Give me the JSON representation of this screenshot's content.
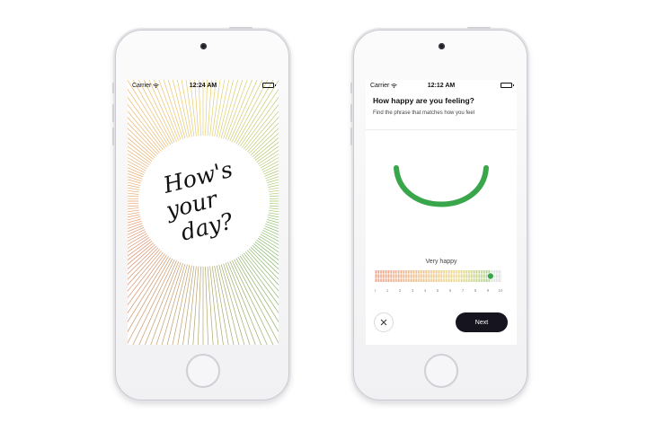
{
  "left_phone": {
    "status": {
      "carrier": "Carrier",
      "time": "12:24 AM"
    },
    "greeting": {
      "lines": [
        "How's",
        "your",
        "day?"
      ]
    }
  },
  "right_phone": {
    "status": {
      "carrier": "Carrier",
      "time": "12:12 AM"
    },
    "header": {
      "title": "How happy are you feeling?",
      "subtitle": "Find the phrase that matches how you feel"
    },
    "mood": {
      "label": "Very happy",
      "scale_labels": [
        "0",
        "1",
        "2",
        "3",
        "4",
        "5",
        "6",
        "7",
        "8",
        "9",
        "10"
      ],
      "scale_min": 0,
      "scale_max": 10,
      "selected_value": 9.2
    },
    "buttons": {
      "next_label": "Next",
      "close_icon": "close-icon"
    }
  },
  "colors": {
    "accent_green": "#3aa64b",
    "ray_top": "#e8d070",
    "ray_left": "#e98a6d",
    "ray_right": "#7cc06a",
    "button_dark": "#15141f"
  }
}
